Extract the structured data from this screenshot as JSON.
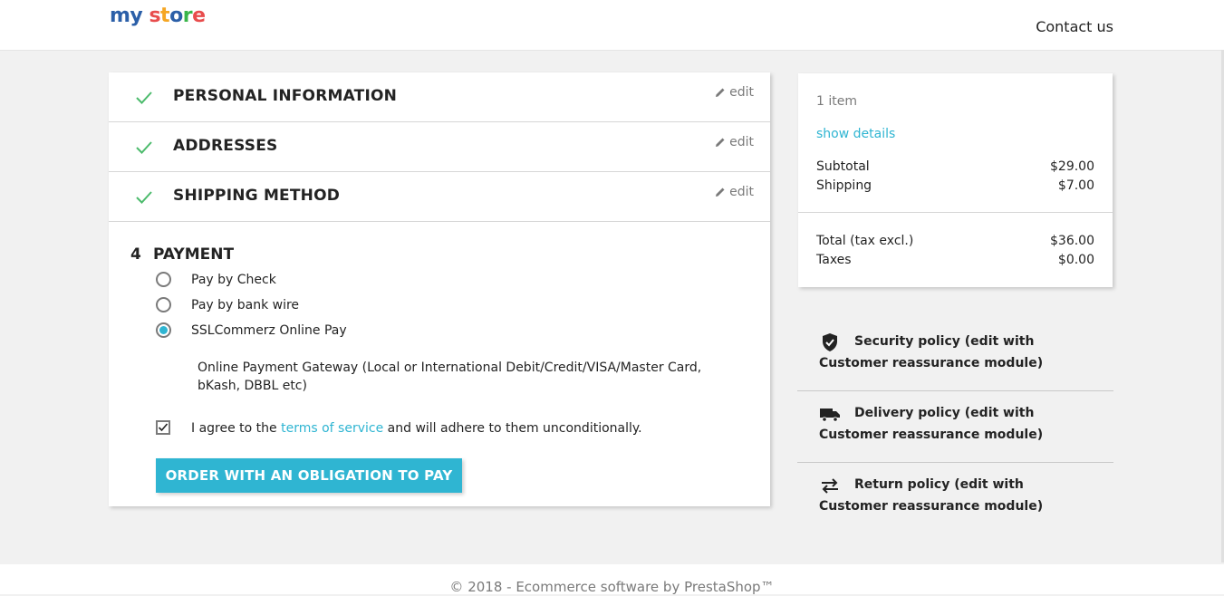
{
  "header": {
    "logo": "my store",
    "contact_label": "Contact us"
  },
  "steps": [
    {
      "title": "PERSONAL INFORMATION",
      "edit_label": "edit"
    },
    {
      "title": "ADDRESSES",
      "edit_label": "edit"
    },
    {
      "title": "SHIPPING METHOD",
      "edit_label": "edit"
    }
  ],
  "payment": {
    "number": "4",
    "title": "PAYMENT",
    "options": [
      {
        "label": "Pay by Check",
        "selected": false
      },
      {
        "label": "Pay by bank wire",
        "selected": false
      },
      {
        "label": "SSLCommerz Online Pay",
        "selected": true
      }
    ],
    "gateway_text": "Online Payment Gateway (Local or International Debit/Credit/VISA/Master Card, bKash, DBBL etc)",
    "agree_prefix": "I agree to the ",
    "agree_link": "terms of service",
    "agree_suffix": " and will adhere to them unconditionally.",
    "agree_checked": true,
    "order_button": "ORDER WITH AN OBLIGATION TO PAY"
  },
  "summary": {
    "items": "1 item",
    "show_details": "show details",
    "subtotal_label": "Subtotal",
    "subtotal_value": "$29.00",
    "shipping_label": "Shipping",
    "shipping_value": "$7.00",
    "total_label": "Total (tax excl.)",
    "total_value": "$36.00",
    "taxes_label": "Taxes",
    "taxes_value": "$0.00"
  },
  "reassurance": [
    {
      "icon": "shield-icon",
      "text": "Security policy (edit with Customer reassurance module)"
    },
    {
      "icon": "truck-icon",
      "text": "Delivery policy (edit with Customer reassurance module)"
    },
    {
      "icon": "swap-arrows-icon",
      "text": "Return policy (edit with Customer reassurance module)"
    }
  ],
  "footer": {
    "copyright": "© 2018 - Ecommerce software by PrestaShop™"
  },
  "colors": {
    "accent": "#2fb5d2",
    "check_green": "#4cbb6c",
    "background": "#f1f1f1"
  }
}
